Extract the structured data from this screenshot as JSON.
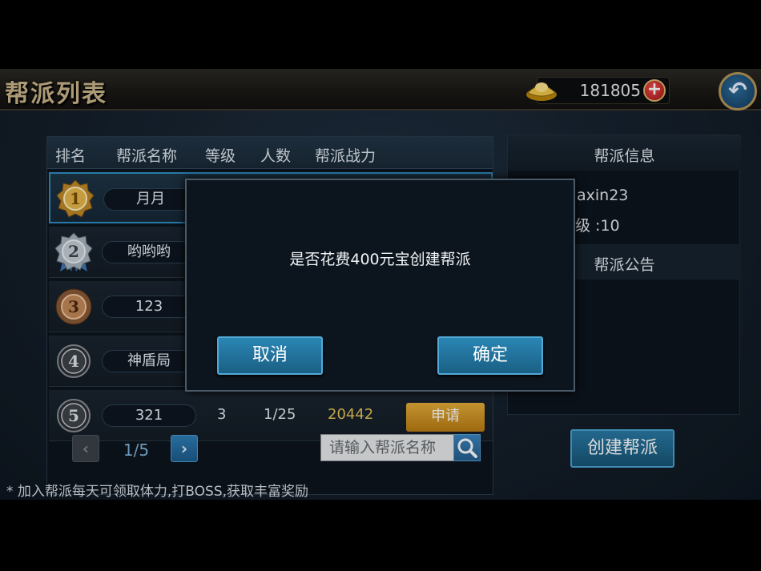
{
  "header": {
    "title": "帮派列表",
    "gold_amount": "181805",
    "plus_icon": "plus-icon",
    "back_icon": "return-arrow-icon"
  },
  "guild_list": {
    "columns": [
      "排名",
      "帮派名称",
      "等级",
      "人数",
      "帮派战力"
    ],
    "rows": [
      {
        "rank": "1",
        "name": "月月",
        "selected": true
      },
      {
        "rank": "2",
        "name": "哟哟哟"
      },
      {
        "rank": "3",
        "name": "123"
      },
      {
        "rank": "4",
        "name": "神盾局"
      },
      {
        "rank": "5",
        "name": "321",
        "level": "3",
        "members": "1/25",
        "power": "20442",
        "apply_label": "申请"
      }
    ]
  },
  "pagination": {
    "prev_icon": "chevron-left-icon",
    "page": "1/5",
    "next_icon": "chevron-right-icon"
  },
  "search": {
    "placeholder": "请输入帮派名称",
    "icon": "search-icon"
  },
  "info_panel": {
    "title": "帮派信息",
    "leader_partial": "axin23",
    "level_partial": "级 :10",
    "notice_title": "帮派公告"
  },
  "create_button": "创建帮派",
  "footer_note": "* 加入帮派每天可领取体力,打BOSS,获取丰富奖励",
  "modal": {
    "message": "是否花费400元宝创建帮派",
    "cancel_label": "取消",
    "confirm_label": "确定"
  },
  "colors": {
    "accent_blue": "#2a86b4",
    "gold_text": "#e6c35a",
    "apply_orange": "#e6ae3a"
  }
}
